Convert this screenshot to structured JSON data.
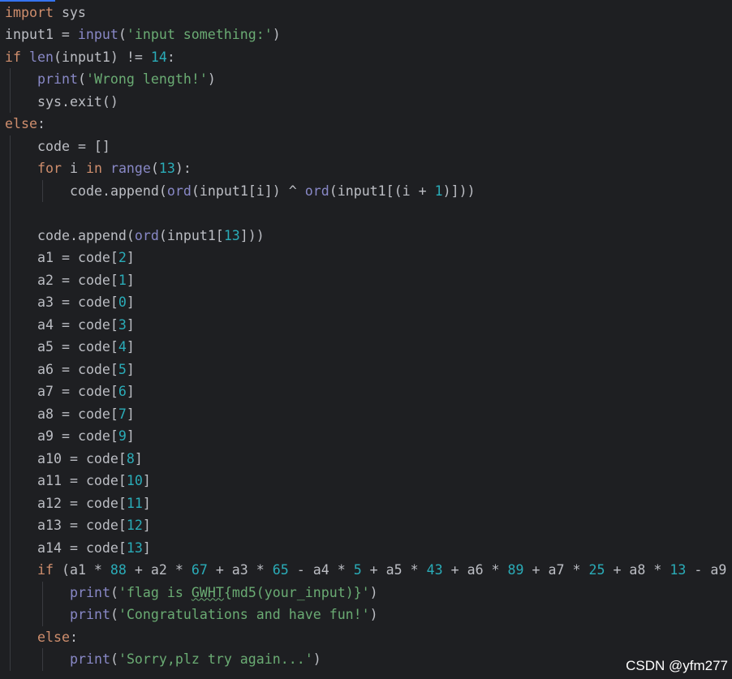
{
  "editor": {
    "theme_background": "#1e1f22",
    "colors": {
      "keyword": "#cf8e6d",
      "builtin": "#8888c6",
      "string": "#6aab73",
      "number": "#2aacb8",
      "text": "#bcbec4"
    },
    "lines": [
      {
        "tokens": [
          [
            "kw",
            "import"
          ],
          [
            "tx",
            " sys"
          ]
        ]
      },
      {
        "tokens": [
          [
            "tx",
            "input1 = "
          ],
          [
            "bi",
            "input"
          ],
          [
            "tx",
            "("
          ],
          [
            "str",
            "'input something:'"
          ],
          [
            "tx",
            ")"
          ]
        ]
      },
      {
        "tokens": [
          [
            "kw",
            "if "
          ],
          [
            "bi",
            "len"
          ],
          [
            "tx",
            "(input1) != "
          ],
          [
            "num",
            "14"
          ],
          [
            "tx",
            ":"
          ]
        ]
      },
      {
        "indent": 1,
        "tokens": [
          [
            "bi",
            "print"
          ],
          [
            "tx",
            "("
          ],
          [
            "str",
            "'Wrong length!'"
          ],
          [
            "tx",
            ")"
          ]
        ]
      },
      {
        "indent": 1,
        "tokens": [
          [
            "tx",
            "sys.exit()"
          ]
        ]
      },
      {
        "tokens": [
          [
            "kw",
            "else"
          ],
          [
            "tx",
            ":"
          ]
        ]
      },
      {
        "indent": 1,
        "tokens": [
          [
            "tx",
            "code = []"
          ]
        ]
      },
      {
        "indent": 1,
        "tokens": [
          [
            "kw",
            "for"
          ],
          [
            "tx",
            " i "
          ],
          [
            "kw",
            "in"
          ],
          [
            "tx",
            " "
          ],
          [
            "bi",
            "range"
          ],
          [
            "tx",
            "("
          ],
          [
            "num",
            "13"
          ],
          [
            "tx",
            "):"
          ]
        ]
      },
      {
        "indent": 2,
        "tokens": [
          [
            "tx",
            "code.append("
          ],
          [
            "bi",
            "ord"
          ],
          [
            "tx",
            "(input1[i]) ^ "
          ],
          [
            "bi",
            "ord"
          ],
          [
            "tx",
            "(input1[(i + "
          ],
          [
            "num",
            "1"
          ],
          [
            "tx",
            ")]))"
          ]
        ]
      },
      {
        "tokens": []
      },
      {
        "indent": 1,
        "tokens": [
          [
            "tx",
            "code.append("
          ],
          [
            "bi",
            "ord"
          ],
          [
            "tx",
            "(input1["
          ],
          [
            "num",
            "13"
          ],
          [
            "tx",
            "]))"
          ]
        ]
      },
      {
        "indent": 1,
        "tokens": [
          [
            "tx",
            "a1 = code["
          ],
          [
            "num",
            "2"
          ],
          [
            "tx",
            "]"
          ]
        ]
      },
      {
        "indent": 1,
        "tokens": [
          [
            "tx",
            "a2 = code["
          ],
          [
            "num",
            "1"
          ],
          [
            "tx",
            "]"
          ]
        ]
      },
      {
        "indent": 1,
        "tokens": [
          [
            "tx",
            "a3 = code["
          ],
          [
            "num",
            "0"
          ],
          [
            "tx",
            "]"
          ]
        ]
      },
      {
        "indent": 1,
        "tokens": [
          [
            "tx",
            "a4 = code["
          ],
          [
            "num",
            "3"
          ],
          [
            "tx",
            "]"
          ]
        ]
      },
      {
        "indent": 1,
        "tokens": [
          [
            "tx",
            "a5 = code["
          ],
          [
            "num",
            "4"
          ],
          [
            "tx",
            "]"
          ]
        ]
      },
      {
        "indent": 1,
        "tokens": [
          [
            "tx",
            "a6 = code["
          ],
          [
            "num",
            "5"
          ],
          [
            "tx",
            "]"
          ]
        ]
      },
      {
        "indent": 1,
        "tokens": [
          [
            "tx",
            "a7 = code["
          ],
          [
            "num",
            "6"
          ],
          [
            "tx",
            "]"
          ]
        ]
      },
      {
        "indent": 1,
        "tokens": [
          [
            "tx",
            "a8 = code["
          ],
          [
            "num",
            "7"
          ],
          [
            "tx",
            "]"
          ]
        ]
      },
      {
        "indent": 1,
        "tokens": [
          [
            "tx",
            "a9 = code["
          ],
          [
            "num",
            "9"
          ],
          [
            "tx",
            "]"
          ]
        ]
      },
      {
        "indent": 1,
        "tokens": [
          [
            "tx",
            "a10 = code["
          ],
          [
            "num",
            "8"
          ],
          [
            "tx",
            "]"
          ]
        ]
      },
      {
        "indent": 1,
        "tokens": [
          [
            "tx",
            "a11 = code["
          ],
          [
            "num",
            "10"
          ],
          [
            "tx",
            "]"
          ]
        ]
      },
      {
        "indent": 1,
        "tokens": [
          [
            "tx",
            "a12 = code["
          ],
          [
            "num",
            "11"
          ],
          [
            "tx",
            "]"
          ]
        ]
      },
      {
        "indent": 1,
        "tokens": [
          [
            "tx",
            "a13 = code["
          ],
          [
            "num",
            "12"
          ],
          [
            "tx",
            "]"
          ]
        ]
      },
      {
        "indent": 1,
        "tokens": [
          [
            "tx",
            "a14 = code["
          ],
          [
            "num",
            "13"
          ],
          [
            "tx",
            "]"
          ]
        ]
      },
      {
        "indent": 1,
        "tokens": [
          [
            "kw",
            "if"
          ],
          [
            "tx",
            " (a1 * "
          ],
          [
            "num",
            "88"
          ],
          [
            "tx",
            " + a2 * "
          ],
          [
            "num",
            "67"
          ],
          [
            "tx",
            " + a3 * "
          ],
          [
            "num",
            "65"
          ],
          [
            "tx",
            " - a4 * "
          ],
          [
            "num",
            "5"
          ],
          [
            "tx",
            " + a5 * "
          ],
          [
            "num",
            "43"
          ],
          [
            "tx",
            " + a6 * "
          ],
          [
            "num",
            "89"
          ],
          [
            "tx",
            " + a7 * "
          ],
          [
            "num",
            "25"
          ],
          [
            "tx",
            " + a8 * "
          ],
          [
            "num",
            "13"
          ],
          [
            "tx",
            " - a9"
          ]
        ]
      },
      {
        "indent": 2,
        "tokens": [
          [
            "bi",
            "print"
          ],
          [
            "tx",
            "("
          ],
          [
            "str",
            "'flag is "
          ],
          [
            "str-typo",
            "GWHT"
          ],
          [
            "str",
            "{md5(your_input)}'"
          ],
          [
            "tx",
            ")"
          ]
        ]
      },
      {
        "indent": 2,
        "tokens": [
          [
            "bi",
            "print"
          ],
          [
            "tx",
            "("
          ],
          [
            "str",
            "'Congratulations and have fun!'"
          ],
          [
            "tx",
            ")"
          ]
        ]
      },
      {
        "indent": 1,
        "tokens": [
          [
            "kw",
            "else"
          ],
          [
            "tx",
            ":"
          ]
        ]
      },
      {
        "indent": 2,
        "tokens": [
          [
            "bi",
            "print"
          ],
          [
            "tx",
            "("
          ],
          [
            "str",
            "'Sorry,plz try again...'"
          ],
          [
            "tx",
            ")"
          ]
        ]
      }
    ]
  },
  "watermark": "CSDN @yfm277"
}
